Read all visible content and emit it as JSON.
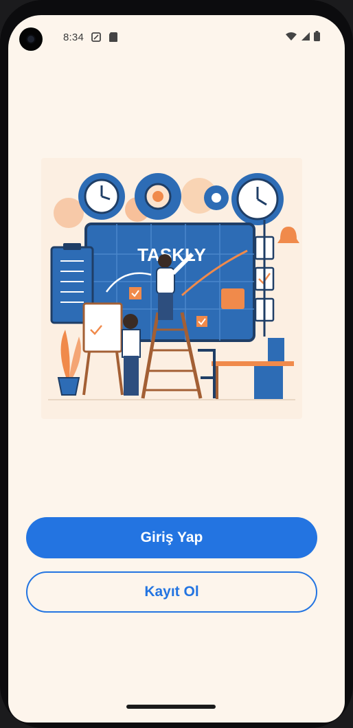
{
  "status_bar": {
    "time": "8:34"
  },
  "illustration": {
    "brand_text": "TASKLY"
  },
  "actions": {
    "login_label": "Giriş Yap",
    "register_label": "Kayıt Ol"
  },
  "colors": {
    "background": "#fdf5ec",
    "primary": "#2374e1",
    "accent_orange": "#f08a4b",
    "board_blue": "#2d6cb5"
  }
}
